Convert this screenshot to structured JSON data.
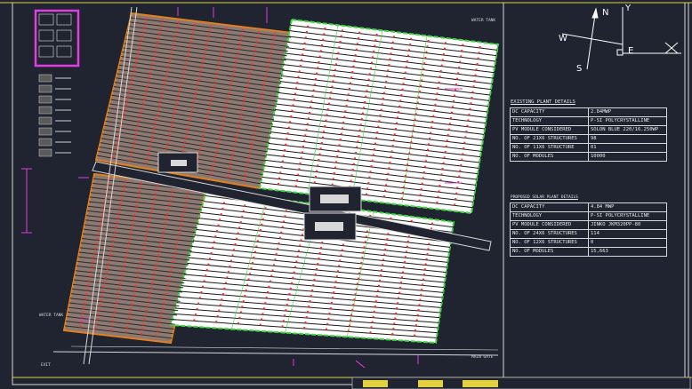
{
  "colors": {
    "background": "#1f2430",
    "existing_plant": "#8c7a72",
    "existing_border": "#e0801f",
    "proposed_plant": "#ffffff",
    "proposed_border": "#3fd63f",
    "marker": "#ff2a2a",
    "magenta": "#e23ce2",
    "road": "#d8d8d8"
  },
  "compass": {
    "north": "N",
    "south": "S",
    "east": "E",
    "west": "W",
    "axis_x": "X",
    "axis_y": "Y"
  },
  "existing_plant": {
    "title": "EXISTING PLANT DETAILS",
    "rows": [
      {
        "key": "DC CAPACITY",
        "value": "2.84MWp"
      },
      {
        "key": "TECHNOLOGY",
        "value": "P-SI POLYCRYSTALLINE"
      },
      {
        "key": "PV MODULE CONSIDERED",
        "value": "SOLON BLUE 220/16.250Wp"
      },
      {
        "key": "NO. OF 21X6 STRUCTURES",
        "value": "98"
      },
      {
        "key": "NO. OF 11X6 STRUCTURE",
        "value": "01"
      },
      {
        "key": "NO. OF MODULES",
        "value": "10000"
      }
    ]
  },
  "proposed_plant": {
    "title": "PROPOSED SOLAR PLANT DETAILS",
    "rows": [
      {
        "key": "DC CAPACITY",
        "value": "4.84 MWp"
      },
      {
        "key": "TECHNOLOGY",
        "value": "P-SI POLYCRYSTALLINE"
      },
      {
        "key": "PV MODULE CONSIDERED",
        "value": "JINKO JKM320PP-80"
      },
      {
        "key": "NO. OF 24X6 STRUCTURES",
        "value": "114"
      },
      {
        "key": "NO. OF 12X6 STRUCTURES",
        "value": "0"
      },
      {
        "key": "NO. OF MODULES",
        "value": "15,663"
      }
    ]
  },
  "labels": {
    "water_tank": "WATER TANK",
    "main_gate": "MAIN GATE",
    "exit": "EXIT",
    "water_tank_2": "WATER TANK"
  }
}
